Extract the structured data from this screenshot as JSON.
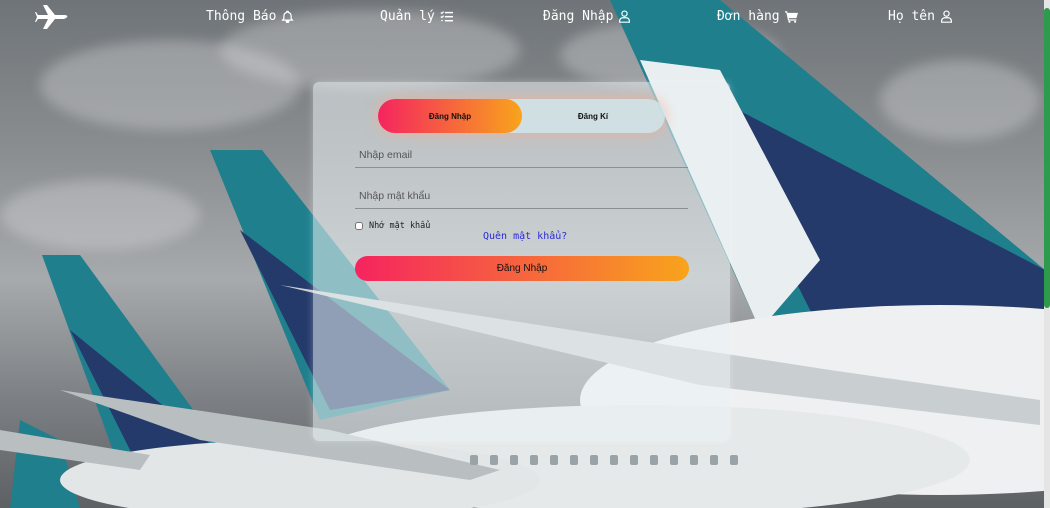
{
  "nav": {
    "items": [
      {
        "label": "Thông Báo",
        "icon": "bell-icon"
      },
      {
        "label": "Quản lý",
        "icon": "tasks-icon"
      },
      {
        "label": "Đăng Nhập",
        "icon": "user-icon"
      },
      {
        "label": "Đơn hàng",
        "icon": "cart-icon"
      },
      {
        "label": "Họ tên",
        "icon": "user-icon"
      }
    ]
  },
  "auth": {
    "tabs": {
      "login": "Đăng Nhập",
      "register": "Đăng Kí"
    },
    "active_tab": "login",
    "email_placeholder": "Nhập email",
    "password_placeholder": "Nhập mật khẩu",
    "remember_label": "Nhớ mật khẩu",
    "forgot_link": "Quên mật khẩu?",
    "submit_label": "Đăng Nhập"
  },
  "colors": {
    "gradient_start": "#f5245f",
    "gradient_end": "#f8a41c",
    "link": "#2a2ad8",
    "airline_teal": "#1f7f8c",
    "airline_navy": "#243a6b"
  }
}
